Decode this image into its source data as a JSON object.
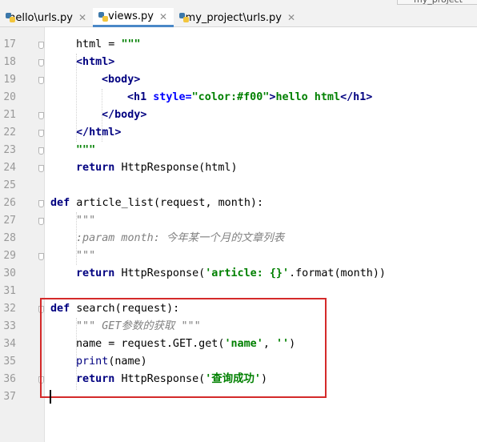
{
  "tabs": [
    {
      "label": "hello\\urls.py",
      "active": false
    },
    {
      "label": "views.py",
      "active": true
    },
    {
      "label": "my_project\\urls.py",
      "active": false
    }
  ],
  "close_glyph": "✕",
  "project_label": "my_project",
  "lines": [
    {
      "n": "17",
      "segs": [
        {
          "t": "html = ",
          "c": ""
        },
        {
          "t": "\"\"\"",
          "c": "str"
        }
      ]
    },
    {
      "n": "18",
      "segs": [
        {
          "t": "<html>",
          "c": "tag"
        }
      ]
    },
    {
      "n": "19",
      "segs": [
        {
          "t": "<body>",
          "c": "tag"
        }
      ]
    },
    {
      "n": "20",
      "segs": [
        {
          "t": "<h1 ",
          "c": "tag"
        },
        {
          "t": "style=",
          "c": "attr"
        },
        {
          "t": "\"color:#f00\"",
          "c": "str"
        },
        {
          "t": ">",
          "c": "tag"
        },
        {
          "t": "hello html",
          "c": "str"
        },
        {
          "t": "</h1>",
          "c": "tag"
        }
      ]
    },
    {
      "n": "21",
      "segs": [
        {
          "t": "</body>",
          "c": "tag"
        }
      ]
    },
    {
      "n": "22",
      "segs": [
        {
          "t": "</html>",
          "c": "tag"
        }
      ]
    },
    {
      "n": "23",
      "segs": [
        {
          "t": "\"\"\"",
          "c": "str"
        }
      ]
    },
    {
      "n": "24",
      "segs": [
        {
          "t": "return ",
          "c": "kw"
        },
        {
          "t": "HttpResponse(html)",
          "c": ""
        }
      ]
    },
    {
      "n": "25",
      "segs": []
    },
    {
      "n": "26",
      "segs": [
        {
          "t": "def ",
          "c": "kw"
        },
        {
          "t": "article_list(request, month):",
          "c": ""
        }
      ]
    },
    {
      "n": "27",
      "segs": [
        {
          "t": "\"\"\"",
          "c": "doc"
        }
      ]
    },
    {
      "n": "28",
      "segs": [
        {
          "t": ":param month: 今年某一个月的文章列表",
          "c": "doc"
        }
      ]
    },
    {
      "n": "29",
      "segs": [
        {
          "t": "\"\"\"",
          "c": "doc"
        }
      ]
    },
    {
      "n": "30",
      "segs": [
        {
          "t": "return ",
          "c": "kw"
        },
        {
          "t": "HttpResponse(",
          "c": ""
        },
        {
          "t": "'article: {}'",
          "c": "str"
        },
        {
          "t": ".format(month))",
          "c": ""
        }
      ]
    },
    {
      "n": "31",
      "segs": []
    },
    {
      "n": "32",
      "segs": [
        {
          "t": "def ",
          "c": "kw"
        },
        {
          "t": "search(request):",
          "c": ""
        }
      ]
    },
    {
      "n": "33",
      "segs": [
        {
          "t": "\"\"\" GET参数的获取 \"\"\"",
          "c": "doc"
        }
      ]
    },
    {
      "n": "34",
      "segs": [
        {
          "t": "name = request.GET.get(",
          "c": ""
        },
        {
          "t": "'name'",
          "c": "str"
        },
        {
          "t": ", ",
          "c": ""
        },
        {
          "t": "''",
          "c": "str"
        },
        {
          "t": ")",
          "c": ""
        }
      ]
    },
    {
      "n": "35",
      "segs": [
        {
          "t": "print",
          "c": "bi"
        },
        {
          "t": "(name)",
          "c": ""
        }
      ]
    },
    {
      "n": "36",
      "segs": [
        {
          "t": "return ",
          "c": "kw"
        },
        {
          "t": "HttpResponse(",
          "c": ""
        },
        {
          "t": "'查询成功'",
          "c": "str"
        },
        {
          "t": ")",
          "c": ""
        }
      ]
    },
    {
      "n": "37",
      "segs": []
    }
  ]
}
